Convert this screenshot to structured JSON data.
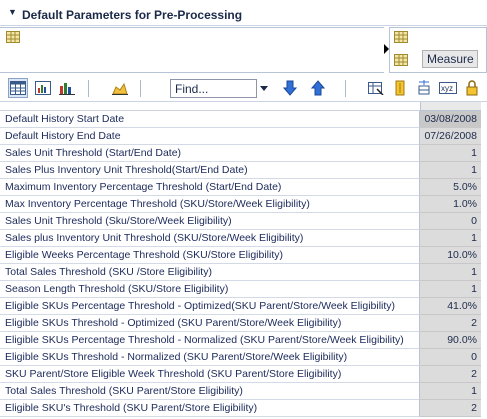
{
  "panel": {
    "title": "Default Parameters for Pre-Processing"
  },
  "measure_area": {
    "button_label": "Measure"
  },
  "toolbar": {
    "find_placeholder": "Find..."
  },
  "grid": {
    "rows": [
      {
        "label": "Default History Start Date",
        "value": "03/08/2008"
      },
      {
        "label": "Default History End Date",
        "value": "07/26/2008"
      },
      {
        "label": "Sales Unit Threshold (Start/End Date)",
        "value": "1"
      },
      {
        "label": "Sales Plus Inventory Unit Threshold(Start/End Date)",
        "value": "1"
      },
      {
        "label": "Maximum Inventory Percentage Threshold (Start/End Date)",
        "value": "5.0%"
      },
      {
        "label": "Max Inventory Percentage Threshold (SKU/Store/Week Eligibility)",
        "value": "1.0%"
      },
      {
        "label": "Sales Unit Threshold (Sku/Store/Week Eligibility)",
        "value": "0"
      },
      {
        "label": "Sales plus Inventory Unit Threshold (SKU/Store/Week Eligibility)",
        "value": "1"
      },
      {
        "label": "Eligible Weeks Percentage Threshold (SKU/Store Eligibility)",
        "value": "10.0%"
      },
      {
        "label": "Total Sales Threshold (SKU /Store Eligibility)",
        "value": "1"
      },
      {
        "label": "Season Length Threshold (SKU/Store Eligibility)",
        "value": "1"
      },
      {
        "label": "Eligible SKUs Percentage Threshold - Optimized(SKU Parent/Store/Week Eligibility)",
        "value": "41.0%"
      },
      {
        "label": "Eligible SKUs Threshold - Optimized (SKU Parent/Store/Week Eligibility)",
        "value": "2"
      },
      {
        "label": "Eligible SKUs Percentage Threshold - Normalized (SKU Parent/Store/Week Eligibility)",
        "value": "90.0%"
      },
      {
        "label": "Eligible SKUs Threshold - Normalized (SKU Parent/Store/Week Eligibility)",
        "value": "0"
      },
      {
        "label": "SKU Parent/Store Eligible Week Threshold (SKU Parent/Store Eligibility)",
        "value": "2"
      },
      {
        "label": "Total Sales Threshold (SKU Parent/Store Eligibility)",
        "value": "1"
      },
      {
        "label": "Eligible SKU's Threshold (SKU Parent/Store Eligibility)",
        "value": "2"
      }
    ]
  },
  "colors": {
    "header_text": "#1c2a4a",
    "label_text": "#1c2a5a",
    "value_cell_bg": "#dcdcdc",
    "arrow_blue": "#2f6fd6"
  }
}
